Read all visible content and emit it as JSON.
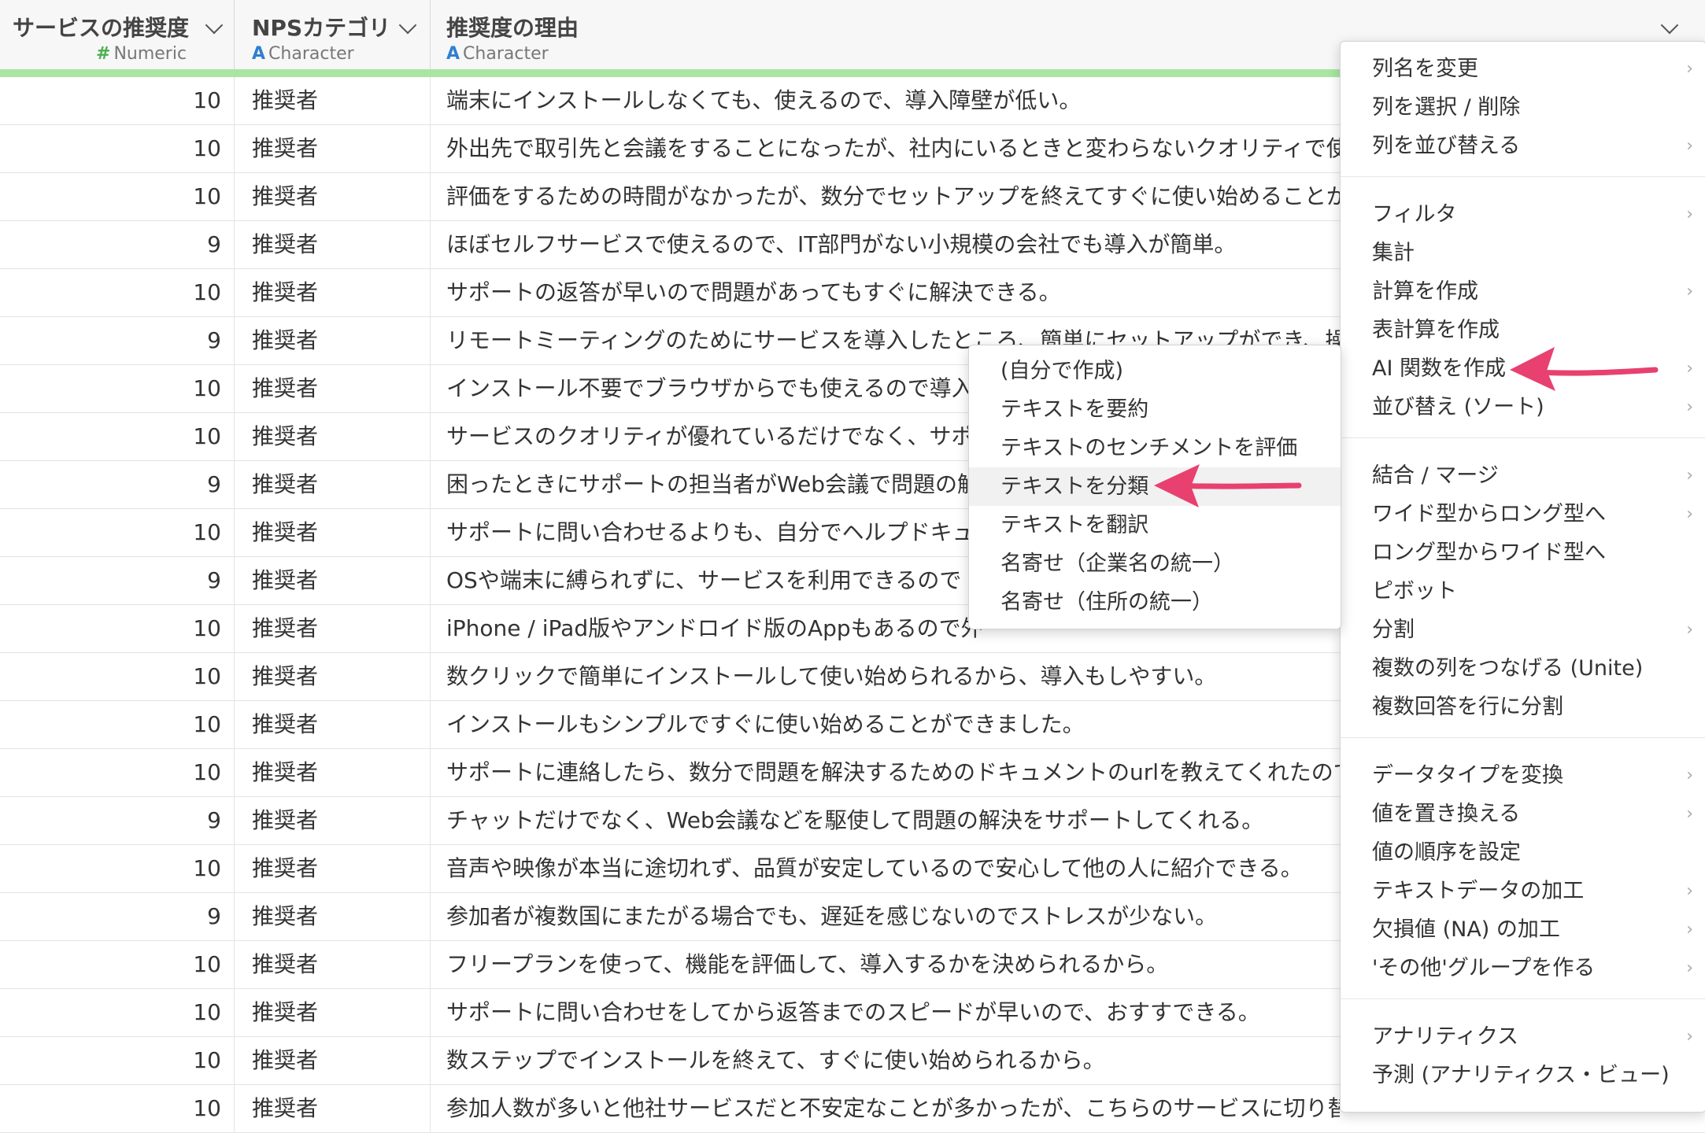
{
  "columns": [
    {
      "name": "サービスの推奨度",
      "type_glyph": "#",
      "type": "Numeric"
    },
    {
      "name": "NPSカテゴリ",
      "type_glyph": "A",
      "type": "Character"
    },
    {
      "name": "推奨度の理由",
      "type_glyph": "A",
      "type": "Character"
    }
  ],
  "rows": [
    {
      "score": "10",
      "category": "推奨者",
      "reason": "端末にインストールしなくても、使えるので、導入障壁が低い。"
    },
    {
      "score": "10",
      "category": "推奨者",
      "reason": "外出先で取引先と会議をすることになったが、社内にいるときと変わらないクオリティで使"
    },
    {
      "score": "10",
      "category": "推奨者",
      "reason": "評価をするための時間がなかったが、数分でセットアップを終えてすぐに使い始めることが"
    },
    {
      "score": "9",
      "category": "推奨者",
      "reason": "ほぼセルフサービスで使えるので、IT部門がない小規模の会社でも導入が簡単。"
    },
    {
      "score": "10",
      "category": "推奨者",
      "reason": "サポートの返答が早いので問題があってもすぐに解決できる。"
    },
    {
      "score": "9",
      "category": "推奨者",
      "reason": "リモートミーティングのためにサービスを導入したところ、簡単にセットアップができ、操"
    },
    {
      "score": "10",
      "category": "推奨者",
      "reason": "インストール不要でブラウザからでも使えるので導入"
    },
    {
      "score": "10",
      "category": "推奨者",
      "reason": "サービスのクオリティが優れているだけでなく、サポ"
    },
    {
      "score": "9",
      "category": "推奨者",
      "reason": "困ったときにサポートの担当者がWeb会議で問題の解"
    },
    {
      "score": "10",
      "category": "推奨者",
      "reason": "サポートに問い合わせるよりも、自分でヘルプドキュ"
    },
    {
      "score": "9",
      "category": "推奨者",
      "reason": "OSや端末に縛られずに、サービスを利用できるので"
    },
    {
      "score": "10",
      "category": "推奨者",
      "reason": "iPhone / iPad版やアンドロイド版のAppもあるので外"
    },
    {
      "score": "10",
      "category": "推奨者",
      "reason": "数クリックで簡単にインストールして使い始められるから、導入もしやすい。"
    },
    {
      "score": "10",
      "category": "推奨者",
      "reason": "インストールもシンプルですぐに使い始めることができました。"
    },
    {
      "score": "10",
      "category": "推奨者",
      "reason": "サポートに連絡したら、数分で問題を解決するためのドキュメントのurlを教えてくれたので"
    },
    {
      "score": "9",
      "category": "推奨者",
      "reason": "チャットだけでなく、Web会議などを駆使して問題の解決をサポートしてくれる。"
    },
    {
      "score": "10",
      "category": "推奨者",
      "reason": "音声や映像が本当に途切れず、品質が安定しているので安心して他の人に紹介できる。"
    },
    {
      "score": "9",
      "category": "推奨者",
      "reason": "参加者が複数国にまたがる場合でも、遅延を感じないのでストレスが少ない。"
    },
    {
      "score": "10",
      "category": "推奨者",
      "reason": "フリープランを使って、機能を評価して、導入するかを決められるから。"
    },
    {
      "score": "10",
      "category": "推奨者",
      "reason": "サポートに問い合わせをしてから返答までのスピードが早いので、おすすできる。"
    },
    {
      "score": "10",
      "category": "推奨者",
      "reason": "数ステップでインストールを終えて、すぐに使い始められるから。"
    },
    {
      "score": "10",
      "category": "推奨者",
      "reason": "参加人数が多いと他社サービスだと不安定なことが多かったが、こちらのサービスに切り替"
    }
  ],
  "column_menu": {
    "groups": [
      [
        {
          "label": "列名を変更",
          "has_sub": true
        },
        {
          "label": "列を選択 / 削除",
          "has_sub": false
        },
        {
          "label": "列を並び替える",
          "has_sub": true
        }
      ],
      [
        {
          "label": "フィルタ",
          "has_sub": true
        },
        {
          "label": "集計",
          "has_sub": false
        },
        {
          "label": "計算を作成",
          "has_sub": true
        },
        {
          "label": "表計算を作成",
          "has_sub": false
        },
        {
          "label": "AI 関数を作成",
          "has_sub": true
        },
        {
          "label": "並び替え (ソート)",
          "has_sub": true
        }
      ],
      [
        {
          "label": "結合 / マージ",
          "has_sub": true
        },
        {
          "label": "ワイド型からロング型へ",
          "has_sub": true
        },
        {
          "label": "ロング型からワイド型へ",
          "has_sub": false
        },
        {
          "label": "ピボット",
          "has_sub": false
        },
        {
          "label": "分割",
          "has_sub": true
        },
        {
          "label": "複数の列をつなげる (Unite)",
          "has_sub": false
        },
        {
          "label": "複数回答を行に分割",
          "has_sub": false
        }
      ],
      [
        {
          "label": "データタイプを変換",
          "has_sub": true
        },
        {
          "label": "値を置き換える",
          "has_sub": true
        },
        {
          "label": "値の順序を設定",
          "has_sub": false
        },
        {
          "label": "テキストデータの加工",
          "has_sub": true
        },
        {
          "label": "欠損値 (NA) の加工",
          "has_sub": true
        },
        {
          "label": "'その他'グループを作る",
          "has_sub": true
        }
      ],
      [
        {
          "label": "アナリティクス",
          "has_sub": true
        },
        {
          "label": "予測 (アナリティクス・ビュー)",
          "has_sub": false
        }
      ]
    ]
  },
  "ai_submenu": {
    "items": [
      "(自分で作成)",
      "テキストを要約",
      "テキストのセンチメントを評価",
      "テキストを分類",
      "テキストを翻訳",
      "名寄せ（企業名の統一）",
      "名寄せ（住所の統一）"
    ],
    "highlighted_index": 3
  },
  "colors": {
    "accent_arrow": "#e8416f",
    "green_bar": "#a9e6a1",
    "numeric_glyph": "#4caf50",
    "character_glyph": "#2f7fd1"
  }
}
